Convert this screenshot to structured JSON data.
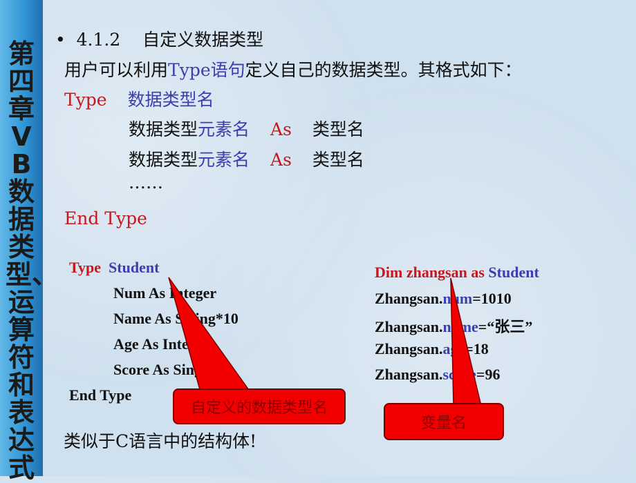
{
  "sidebar": {
    "title": "第四章 VB数据类型、运算符和表达式"
  },
  "heading": {
    "bullet": "•",
    "number": "4.1.2",
    "title": "自定义数据类型"
  },
  "intro": {
    "a": "用户可以利用",
    "b": "Type语句",
    "c": "定义自己的数据类型。其格式如下："
  },
  "syntax": {
    "type_kw": "Type",
    "type_name": "数据类型名",
    "elem_prefix": "数据类型",
    "elem_name": "元素名",
    "as_kw": "As",
    "type_of": "类型名",
    "ellipsis": "……",
    "end": "End Type"
  },
  "example": {
    "type_kw": "Type",
    "name": "Student",
    "fields": [
      "Num As Integer",
      "Name As String*10",
      "Age As Integer",
      "Score As Single"
    ],
    "end": "End Type"
  },
  "usage": {
    "dim": "Dim  zhangsan as",
    "dim_type": "Student",
    "lines": [
      {
        "obj": "Zhangsan.",
        "field": "num",
        "val": "=1010"
      },
      {
        "obj": "Zhangsan.",
        "field": "name",
        "val": "=“张三”"
      },
      {
        "obj": "Zhangsan.",
        "field": "age",
        "val": "=18"
      },
      {
        "obj": "Zhangsan.",
        "field": "score",
        "val": "=96"
      }
    ]
  },
  "callouts": {
    "type_name": "自定义的数据类型名",
    "var_name": "变量名"
  },
  "footer": "类似于C语言中的结构体!",
  "colors": {
    "keyword": "#c8161d",
    "name": "#3a3fb0",
    "callout": "#f20000"
  }
}
